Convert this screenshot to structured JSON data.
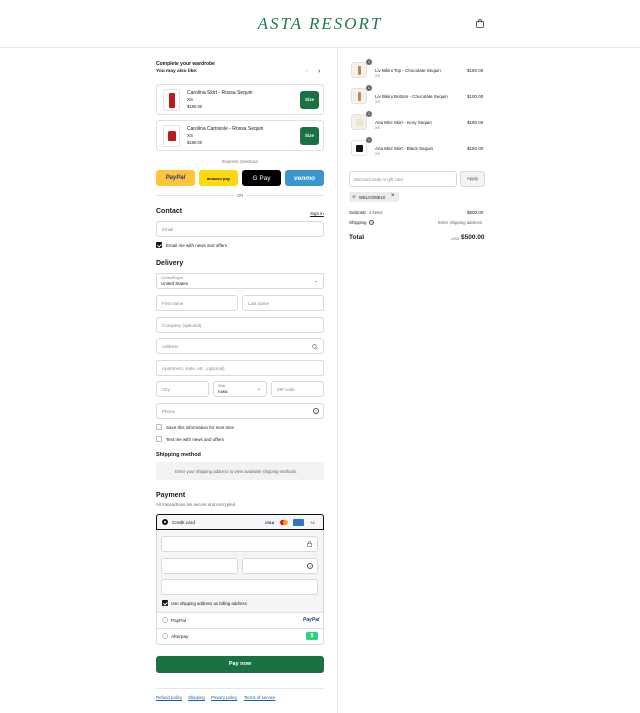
{
  "brand": {
    "name": "ASTA RESORT"
  },
  "colors": {
    "accent": "#1a7244",
    "brand": "#1f7a4c"
  },
  "upsell": {
    "title": "Complete your wardrobe",
    "subtitle": "You may also like:",
    "items": [
      {
        "name": "Carolina Skirt - Rossa Sequin",
        "variant": "XS",
        "price": "$180.00",
        "button": "Size"
      },
      {
        "name": "Carolina Camisole - Rossa Sequin",
        "variant": "XS",
        "price": "$180.00",
        "button": "Size"
      }
    ]
  },
  "express": {
    "label": "Express checkout",
    "or": "OR",
    "paypal": "PayPal",
    "amazon": "amazon pay",
    "gpay": "G Pay",
    "venmo": "venmo"
  },
  "contact": {
    "title": "Contact",
    "signin": "Sign in",
    "email_placeholder": "Email",
    "news": "Email me with news and offers"
  },
  "delivery": {
    "title": "Delivery",
    "country_label": "Country/Region",
    "country_value": "United States",
    "first_name": "First name",
    "last_name": "Last name",
    "company": "Company (optional)",
    "address": "Address",
    "apartment": "Apartment, suite, etc. (optional)",
    "city": "City",
    "state_label": "State",
    "state_value": "Iowa",
    "zip": "ZIP code",
    "phone": "Phone",
    "save_info": "Save this information for next time",
    "text_me": "Text me with news and offers"
  },
  "shipping": {
    "title": "Shipping method",
    "message": "Enter your shipping address to view available shipping methods."
  },
  "payment": {
    "title": "Payment",
    "subtitle": "All transactions are secure and encrypted.",
    "credit_card": "Credit card",
    "more_cards": "+4",
    "billing": "Use shipping address as billing address",
    "paypal": "PayPal",
    "afterpay": "Afterpay",
    "pay_now": "Pay now"
  },
  "footer": {
    "refund": "Refund policy",
    "shipping": "Shipping",
    "privacy": "Privacy policy",
    "terms": "Terms of service"
  },
  "cart": {
    "items": [
      {
        "qty": "1",
        "name": "Liv Bikini Top - Chocolate Sequin",
        "variant": "XS",
        "price": "$150.00"
      },
      {
        "qty": "1",
        "name": "Liv Bikini Bottom - Chocolate Sequin",
        "variant": "XS",
        "price": "$100.00"
      },
      {
        "qty": "1",
        "name": "Ana Mini Skirt - Ivory Sequin",
        "variant": "XS",
        "price": "$150.00"
      },
      {
        "qty": "1",
        "name": "Ana Mini Skirt - Black Sequin",
        "variant": "XS",
        "price": "$150.00"
      }
    ],
    "discount_placeholder": "Discount code or gift card",
    "apply": "Apply",
    "code": "WELCOME10",
    "subtotal_label": "Subtotal",
    "subtotal_items": "4 items",
    "subtotal_value": "$500.00",
    "shipping_label": "Shipping",
    "shipping_value": "Enter shipping address",
    "total_label": "Total",
    "currency": "USD",
    "total_value": "$500.00"
  }
}
